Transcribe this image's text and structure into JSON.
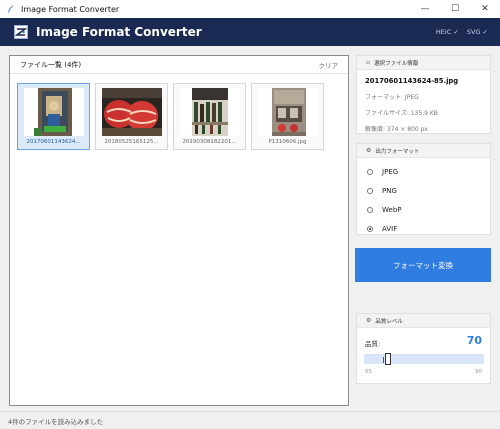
{
  "window": {
    "title": "Image Format Converter",
    "minimize": "—",
    "maximize": "☐",
    "close": "✕"
  },
  "header": {
    "title": "Image Format Converter",
    "formats": [
      "HEIC ✓",
      "SVG ✓"
    ]
  },
  "file_list": {
    "title": "ファイル一覧 (4件)",
    "clear_label": "クリア",
    "files": [
      {
        "name": "20170601143624...",
        "selected": true
      },
      {
        "name": "20180525165125...",
        "selected": false
      },
      {
        "name": "20190308182201...",
        "selected": false
      },
      {
        "name": "P1310606.jpg",
        "selected": false
      }
    ]
  },
  "selected_info": {
    "header": "選択ファイル情報",
    "filename": "20170601143624-85.jpg",
    "format": "フォーマット: JPEG",
    "size": "ファイルサイズ: 135.9 KB",
    "resolution": "解像度: 374 × 800 px"
  },
  "output_format": {
    "header": "出力フォーマット",
    "options": [
      "JPEG",
      "PNG",
      "WebP",
      "AVIF"
    ],
    "selected": "AVIF"
  },
  "convert_button": "フォーマット変換",
  "quality": {
    "header": "品質レベル",
    "label": "品質:",
    "value": "70",
    "min": "65",
    "max": "90",
    "fraction": 0.2
  },
  "status": "4件のファイルを読み込みました",
  "colors": {
    "header_bg": "#1b2a52",
    "accent": "#2f7de0",
    "selected_bg": "#dbe9f9"
  }
}
